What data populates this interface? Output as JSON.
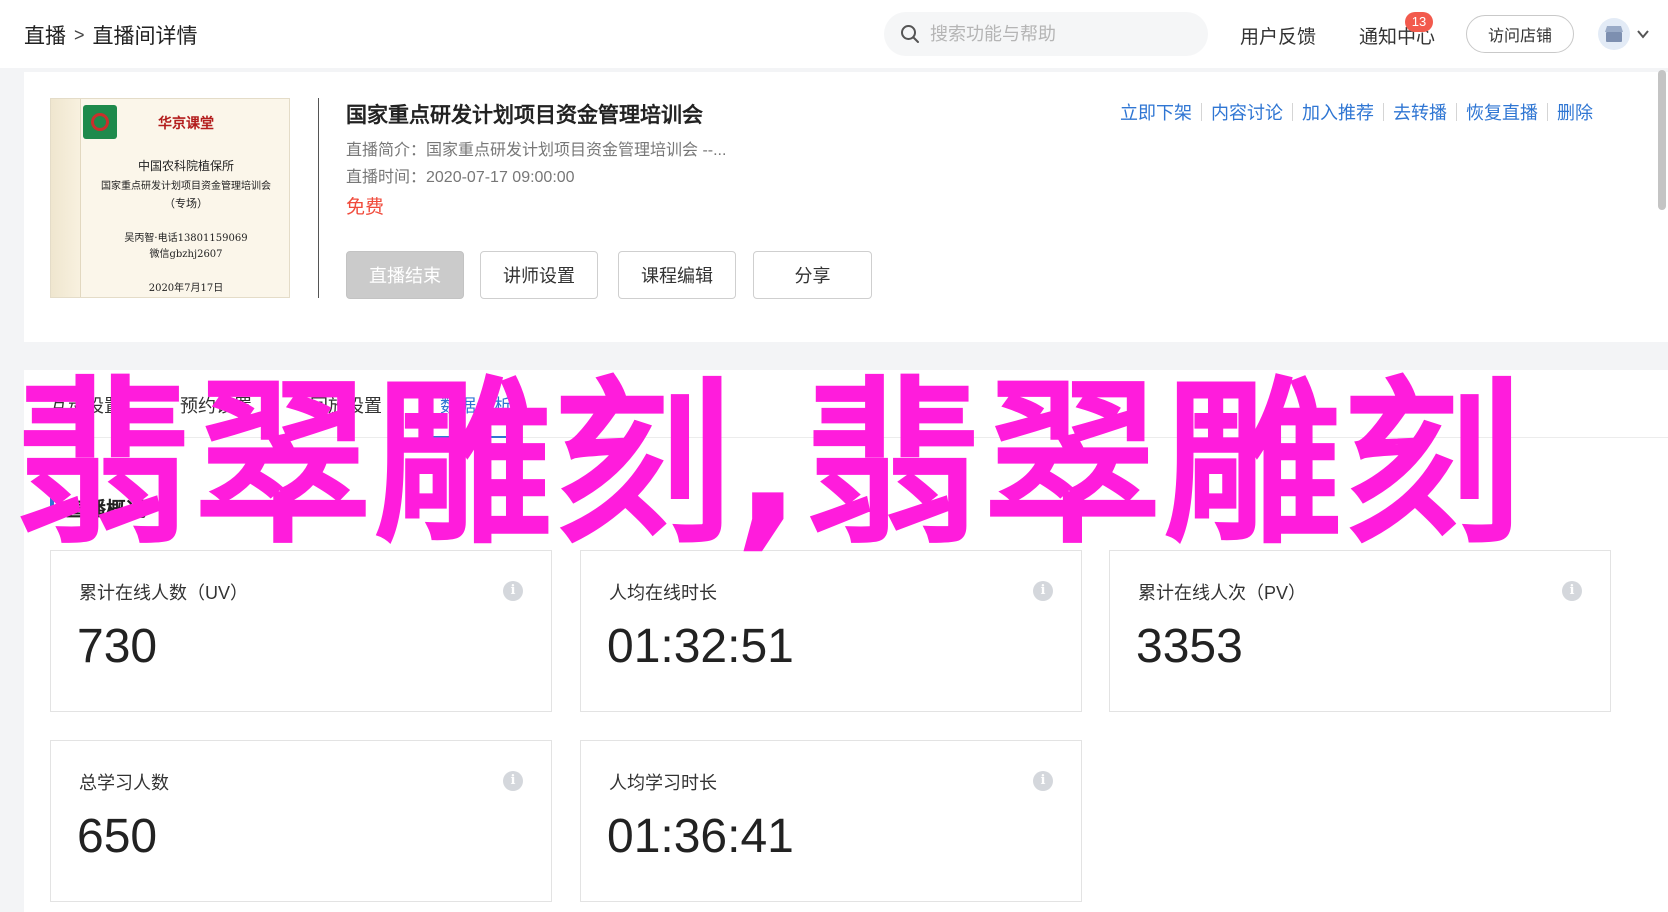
{
  "header": {
    "breadcrumb": [
      "直播",
      "直播间详情"
    ],
    "breadcrumb_sep": ">",
    "search_placeholder": "搜索功能与帮助",
    "feedback": "用户反馈",
    "notifications": "通知中心",
    "notification_count": "13",
    "visit_store": "访问店铺"
  },
  "course": {
    "cover": {
      "brand": "华京课堂",
      "line1": "中国农科院植保所",
      "line2": "国家重点研发计划项目资金管理培训会",
      "line3": "（专场）",
      "line4": "吴丙智·电话13801159069",
      "line5": "微信gbzhj2607",
      "line6": "2020年7月17日"
    },
    "title": "国家重点研发计划项目资金管理培训会",
    "intro": "直播简介：国家重点研发计划项目资金管理培训会 --...",
    "time": "直播时间：2020-07-17 09:00:00",
    "price": "免费",
    "buttons": [
      "直播结束",
      "讲师设置",
      "课程编辑",
      "分享"
    ],
    "ops": [
      "立即下架",
      "内容讨论",
      "加入推荐",
      "去转播",
      "恢复直播",
      "删除"
    ]
  },
  "tabs": [
    "互动设置",
    "预约设置",
    "回放设置",
    "数据分析"
  ],
  "section_title": "直播概况",
  "stats": [
    {
      "label": "累计在线人数（UV）",
      "value": "730"
    },
    {
      "label": "人均在线时长",
      "value": "01:32:51"
    },
    {
      "label": "累计在线人次（PV）",
      "value": "3353"
    },
    {
      "label": "总学习人数",
      "value": "650"
    },
    {
      "label": "人均学习时长",
      "value": "01:36:41"
    }
  ],
  "info_glyph": "i",
  "watermark": "翡翠雕刻,翡翠雕刻",
  "colors": {
    "accent": "#2f76d3",
    "price": "#f04a3b",
    "watermark": "#ff1cdc",
    "badge": "#f25a4d"
  }
}
